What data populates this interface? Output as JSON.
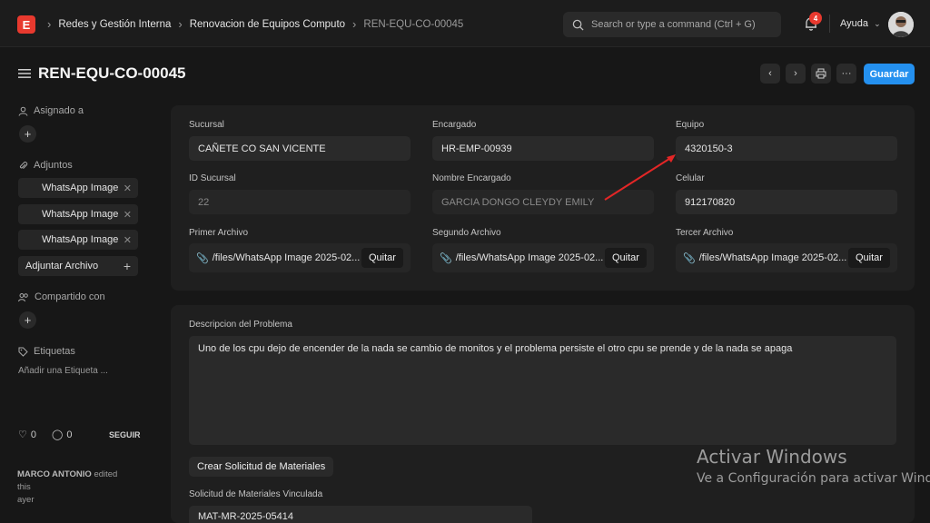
{
  "topbar": {
    "logo_letter": "E",
    "breadcrumbs": [
      "Redes y Gestión Interna",
      "Renovacion de Equipos Computo",
      "REN-EQU-CO-00045"
    ],
    "search_placeholder": "Search or type a command (Ctrl + G)",
    "notification_count": "4",
    "help_label": "Ayuda"
  },
  "header": {
    "title": "REN-EQU-CO-00045",
    "save_label": "Guardar"
  },
  "sidebar": {
    "assigned_label": "Asignado a",
    "attachments_label": "Adjuntos",
    "attachments": [
      "WhatsApp Image",
      "WhatsApp Image",
      "WhatsApp Image"
    ],
    "attach_button": "Adjuntar Archivo",
    "shared_label": "Compartido con",
    "tags_label": "Etiquetas",
    "add_tag": "Añadir una Etiqueta ...",
    "likes": "0",
    "comments": "0",
    "follow": "SEGUIR",
    "activity_user": "MARCO ANTONIO",
    "activity_text": "edited this",
    "activity_time": "ayer"
  },
  "form": {
    "sucursal_label": "Sucursal",
    "sucursal_value": "CAÑETE CO SAN VICENTE",
    "encargado_label": "Encargado",
    "encargado_value": "HR-EMP-00939",
    "equipo_label": "Equipo",
    "equipo_value": "4320150-3",
    "id_sucursal_label": "ID Sucursal",
    "id_sucursal_value": "22",
    "nombre_encargado_label": "Nombre Encargado",
    "nombre_encargado_value": "GARCIA DONGO CLEYDY EMILY",
    "celular_label": "Celular",
    "celular_value": "912170820",
    "primer_archivo_label": "Primer Archivo",
    "primer_archivo_value": "/files/WhatsApp Image 2025-02...",
    "segundo_archivo_label": "Segundo Archivo",
    "segundo_archivo_value": "/files/WhatsApp Image 2025-02...",
    "tercer_archivo_label": "Tercer Archivo",
    "tercer_archivo_value": "/files/WhatsApp Image 2025-02...",
    "quitar_label": "Quitar",
    "descripcion_label": "Descripcion del Problema",
    "descripcion_value": "Uno de los cpu  dejo de encender de la nada se cambio de monitos y el problema persiste el otro cpu se prende y de la nada se apaga",
    "crear_solicitud_label": "Crear Solicitud de Materiales",
    "solicitud_label": "Solicitud de Materiales Vinculada",
    "solicitud_value": "MAT-MR-2025-05414"
  },
  "watermark": {
    "line1": "Activar Windows",
    "line2": "Ve a Configuración para activar Windows."
  },
  "colors": {
    "primary": "#2490ef",
    "logo": "#e8392e",
    "annotation_arrow": "#e32626"
  }
}
